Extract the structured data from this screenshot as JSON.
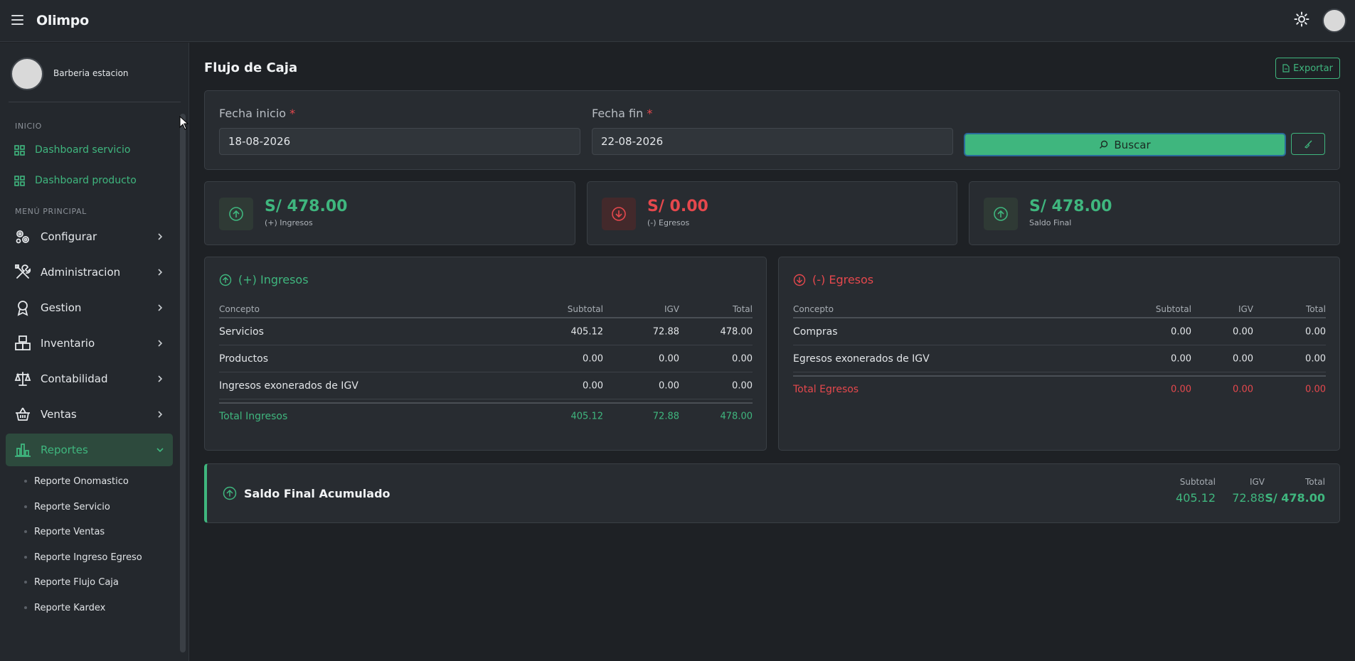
{
  "app": {
    "brand": "Olimpo"
  },
  "user": {
    "business_name": "Barberia estacion"
  },
  "sidebar": {
    "sections": {
      "inicio": "INICIO",
      "principal": "MENÚ PRINCIPAL"
    },
    "dashboards": [
      {
        "label": "Dashboard servicio"
      },
      {
        "label": "Dashboard producto"
      }
    ],
    "menu": [
      {
        "label": "Configurar",
        "icon": "gears-icon"
      },
      {
        "label": "Administracion",
        "icon": "tools-icon"
      },
      {
        "label": "Gestion",
        "icon": "badge-icon"
      },
      {
        "label": "Inventario",
        "icon": "boxes-icon"
      },
      {
        "label": "Contabilidad",
        "icon": "scale-icon"
      },
      {
        "label": "Ventas",
        "icon": "basket-icon"
      },
      {
        "label": "Reportes",
        "icon": "bar-chart-icon",
        "expanded": true
      }
    ],
    "reportes_sub": [
      {
        "label": "Reporte Onomastico"
      },
      {
        "label": "Reporte Servicio"
      },
      {
        "label": "Reporte Ventas"
      },
      {
        "label": "Reporte Ingreso Egreso"
      },
      {
        "label": "Reporte Flujo Caja"
      },
      {
        "label": "Reporte Kardex"
      }
    ]
  },
  "page": {
    "title": "Flujo de Caja",
    "export_label": "Exportar",
    "filters": {
      "start_label": "Fecha inicio",
      "start_value": "18-08-2026",
      "end_label": "Fecha fin",
      "end_value": "22-08-2026",
      "required_mark": "*",
      "search_label": "Buscar"
    },
    "stats": [
      {
        "value": "S/ 478.00",
        "label": "(+) Ingresos",
        "color": "#3fb67e"
      },
      {
        "value": "S/ 0.00",
        "label": "(-) Egresos",
        "color": "#e5484d"
      },
      {
        "value": "S/ 478.00",
        "label": "Saldo Final",
        "color": "#3fb67e"
      }
    ],
    "ingresos": {
      "title": "(+) Ingresos",
      "headers": [
        "Concepto",
        "Subtotal",
        "IGV",
        "Total"
      ],
      "rows": [
        [
          "Servicios",
          "405.12",
          "72.88",
          "478.00"
        ],
        [
          "Productos",
          "0.00",
          "0.00",
          "0.00"
        ],
        [
          "Ingresos exonerados de IGV",
          "0.00",
          "0.00",
          "0.00"
        ]
      ],
      "total": [
        "Total Ingresos",
        "405.12",
        "72.88",
        "478.00"
      ]
    },
    "egresos": {
      "title": "(-) Egresos",
      "headers": [
        "Concepto",
        "Subtotal",
        "IGV",
        "Total"
      ],
      "rows": [
        [
          "Compras",
          "0.00",
          "0.00",
          "0.00"
        ],
        [
          "Egresos exonerados de IGV",
          "0.00",
          "0.00",
          "0.00"
        ]
      ],
      "total": [
        "Total Egresos",
        "0.00",
        "0.00",
        "0.00"
      ]
    },
    "saldo": {
      "title": "Saldo Final Acumulado",
      "subtotal_label": "Subtotal",
      "subtotal": "405.12",
      "igv_label": "IGV",
      "igv": "72.88",
      "total_label": "Total",
      "total": "S/ 478.00"
    }
  }
}
